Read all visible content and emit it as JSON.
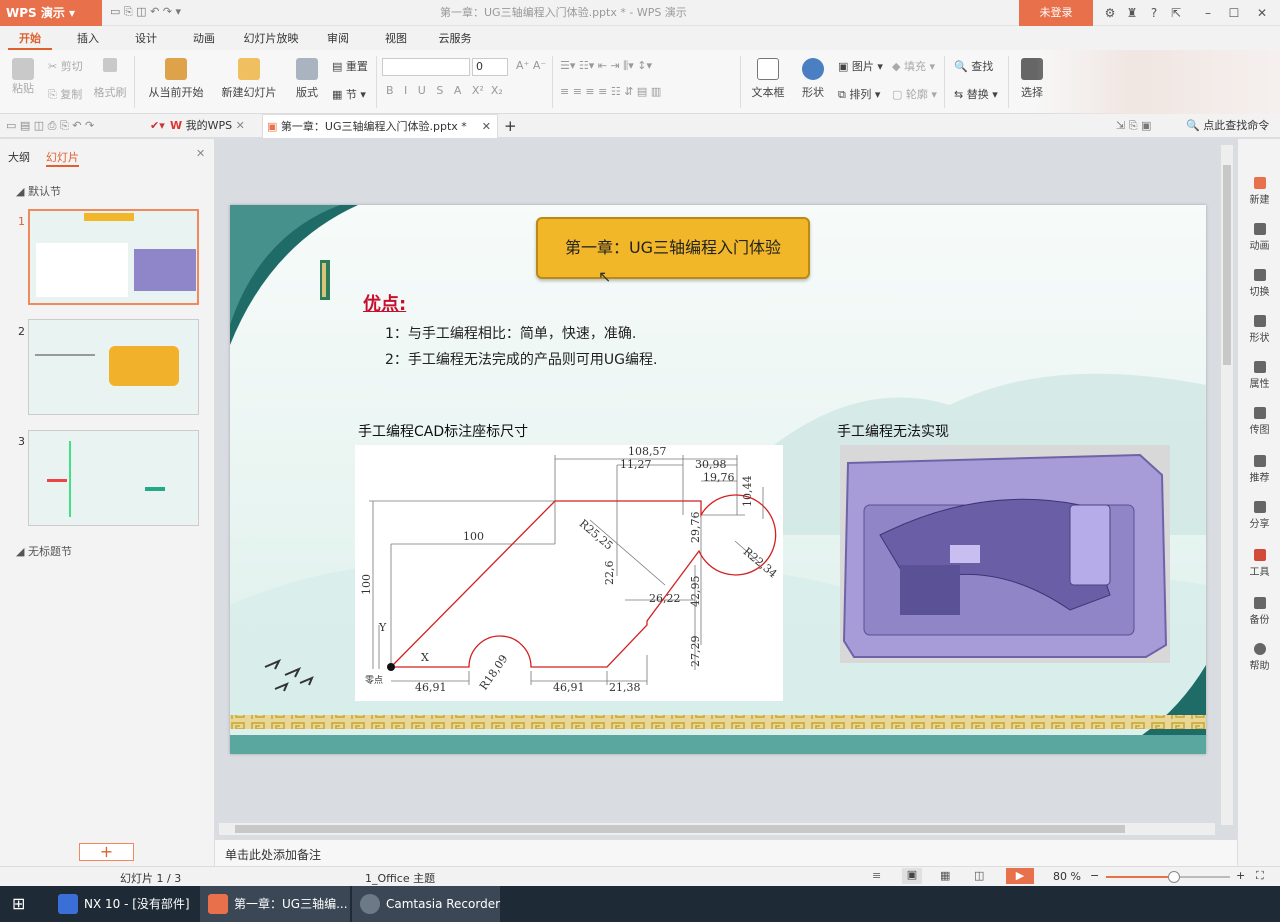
{
  "app": {
    "name": "WPS 演示",
    "window_title": "第一章：UG三轴编程入门体验.pptx * - WPS 演示",
    "login": "未登录"
  },
  "ribbon_tabs": [
    "开始",
    "插入",
    "设计",
    "动画",
    "幻灯片放映",
    "审阅",
    "视图",
    "云服务"
  ],
  "ribbon": {
    "paste": "粘贴",
    "cut": "剪切",
    "copy": "复制",
    "format_painter": "格式刷",
    "from_current": "从当前开始",
    "new_slide": "新建幻灯片",
    "layout": "版式",
    "reset": "重置",
    "section": "节",
    "font_name": "",
    "font_size": "0",
    "bold": "B",
    "italic": "I",
    "underline": "U",
    "strike": "S",
    "font_color": "A",
    "superscript": "X²",
    "subscript": "X₂",
    "textbox": "文本框",
    "shape": "形状",
    "picture": "图片",
    "fill": "填充",
    "arrange": "排列",
    "outline": "轮廓",
    "find": "查找",
    "replace": "替换",
    "select": "选择"
  },
  "doc_tabs": {
    "home": "我的WPS",
    "current": "第一章：UG三轴编程入门体验.pptx *"
  },
  "search_cmd": "点此查找命令",
  "left_panel": {
    "tab_outline": "大纲",
    "tab_slides": "幻灯片",
    "section_default": "默认节",
    "section_untitled": "无标题节",
    "slide_numbers": [
      "1",
      "2",
      "3"
    ],
    "add_button": "+"
  },
  "slide": {
    "title": "第一章：UG三轴编程入门体验",
    "advantages_heading": "优点:",
    "point1": "1：与手工编程相比：简单，快速，准确.",
    "point2": "2：手工编程无法完成的产品则可用UG编程.",
    "cad_caption": "手工编程CAD标注座标尺寸",
    "model_caption": "手工编程无法实现",
    "dims": {
      "d1": "108,57",
      "d2": "11,27",
      "d3": "30,98",
      "d4": "19,76",
      "d5": "10,44",
      "d6": "100",
      "d7": "R25,25",
      "d8": "29,76",
      "d9": "R22,34",
      "d10": "22,6",
      "d11": "42,95",
      "d12": "26,22",
      "d13": "100",
      "d14": "27,29",
      "d15": "Y",
      "d16": "X",
      "d17": "零点",
      "d18": "R18,09",
      "d19": "46,91",
      "d20": "46,91",
      "d21": "21,38"
    }
  },
  "right_panel": [
    "新建",
    "动画",
    "切换",
    "形状",
    "属性",
    "传图",
    "推荐",
    "分享",
    "工具",
    "备份",
    "帮助"
  ],
  "notes_placeholder": "单击此处添加备注",
  "status": {
    "slide_counter": "幻灯片 1 / 3",
    "theme": "1_Office 主题",
    "zoom": "80 %",
    "zoom_value": 0.55
  },
  "taskbar": {
    "nx": "NX 10 - [没有部件]",
    "wps": "第一章：UG三轴编...",
    "camtasia": "Camtasia Recorder"
  },
  "colors": {
    "accent": "#e8704a",
    "scroll_gold": "#f2b728",
    "red_text": "#c8102e",
    "model_purple": "#a79bd8",
    "taskbar": "#1e2a36"
  }
}
